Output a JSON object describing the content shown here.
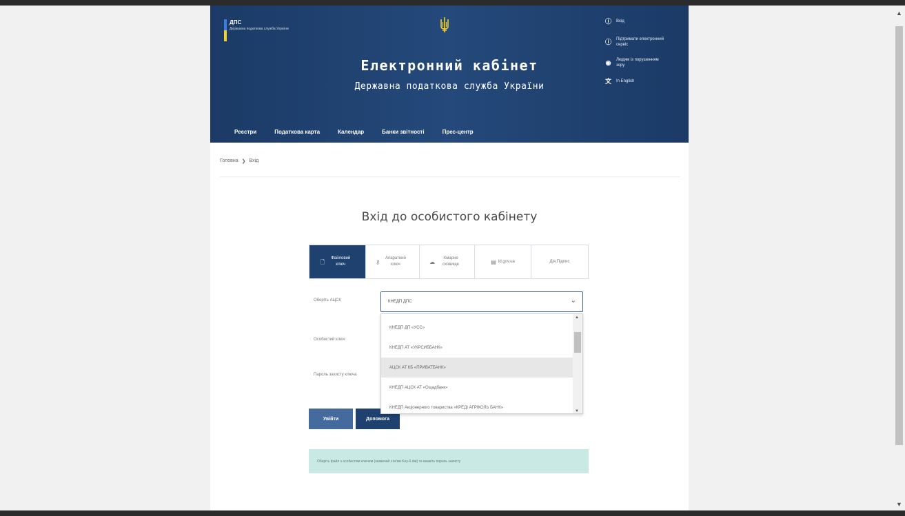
{
  "header": {
    "logo_title": "ДПС",
    "logo_sub": "Державна податкова служба України",
    "title": "Електронний кабінет",
    "subtitle": "Державна податкова служба України",
    "util": [
      {
        "icon": "info-icon",
        "label": "Вхід"
      },
      {
        "icon": "info-icon",
        "label": "Підтримати електронний сервіс"
      },
      {
        "icon": "eye-icon",
        "label": "Людям із порушенням зору"
      },
      {
        "icon": "translate-icon",
        "label": "In English"
      }
    ],
    "nav": [
      "Реєстри",
      "Податкова карта",
      "Календар",
      "Банки звітності",
      "Прес-центр"
    ]
  },
  "breadcrumb": {
    "home": "Головна",
    "sep": "❯",
    "current": "Вхід"
  },
  "login": {
    "title": "Вхід до особистого кабінету",
    "tabs": [
      {
        "icon": "file-icon",
        "label": "Файловий ключ",
        "active": true
      },
      {
        "icon": "key-icon",
        "label": "Апаратний ключ",
        "active": false
      },
      {
        "icon": "cloud-icon",
        "label": "Хмарне сховище",
        "active": false
      },
      {
        "icon": "id-card-icon",
        "label": "Id.gov.ua",
        "active": false
      },
      {
        "icon": "",
        "label": "Дія.Підпис",
        "active": false
      }
    ],
    "labels": {
      "ca": "Оберіть АЦСК",
      "key": "Особистий ключ",
      "password": "Пароль захисту ключа"
    },
    "select_value": "КНЕДП ДПС",
    "dropdown": [
      "КНЕДП ДП «УСС»",
      "КНЕДП АТ «УКРСИББАНК»",
      "АЦСК АТ КБ «ПРИВАТБАНК»",
      "КНЕДП АЦСК АТ «Ощадбанк»",
      "КНЕДП Акціонерного товариства «КРЕДІ АГРІКОЛЬ БАНК»"
    ],
    "dropdown_selected_index": 2,
    "login_button": "Увійти",
    "help_button": "Допомога",
    "info": "Оберіть файл з особистим ключем (зазвичай з ім'ям Key-6.dat) та вкажіть пароль захисту"
  },
  "colors": {
    "header_bg": "#1f4170",
    "info_bg": "#c9e9e4",
    "active_tab": "#1f4170"
  }
}
